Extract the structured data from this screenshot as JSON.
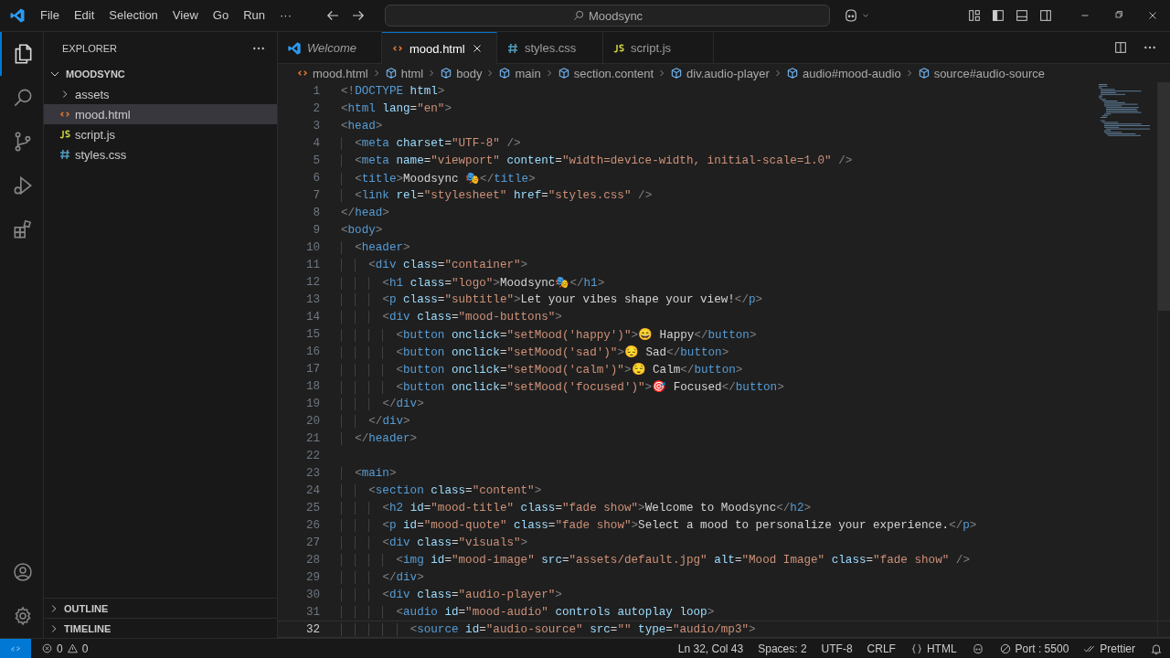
{
  "title_bar": {
    "menu": [
      "File",
      "Edit",
      "Selection",
      "View",
      "Go",
      "Run",
      "···"
    ],
    "search": "Moodsync"
  },
  "activity_bar": {
    "items": [
      {
        "kind": "explorer",
        "selected": true
      },
      {
        "kind": "search",
        "selected": false
      },
      {
        "kind": "source-control",
        "selected": false
      },
      {
        "kind": "run",
        "selected": false
      },
      {
        "kind": "extensions",
        "selected": false
      }
    ]
  },
  "sidebar": {
    "title": "EXPLORER",
    "folder": "MOODSYNC",
    "expanded": true,
    "items": [
      {
        "name": "assets",
        "kind": "folder",
        "selected": false
      },
      {
        "name": "mood.html",
        "kind": "html",
        "selected": true
      },
      {
        "name": "script.js",
        "kind": "js",
        "selected": false
      },
      {
        "name": "styles.css",
        "kind": "css",
        "selected": false
      }
    ],
    "sections": [
      {
        "name": "OUTLINE",
        "expanded": false
      },
      {
        "name": "TIMELINE",
        "expanded": false
      }
    ]
  },
  "tabs": [
    {
      "label": "Welcome",
      "kind": "welcome",
      "selected": false
    },
    {
      "label": "mood.html",
      "kind": "html",
      "selected": true
    },
    {
      "label": "styles.css",
      "kind": "css",
      "selected": false
    },
    {
      "label": "script.js",
      "kind": "js",
      "selected": false
    }
  ],
  "breadcrumb": [
    {
      "label": "mood.html",
      "kind": "html"
    },
    {
      "label": "html",
      "kind": "element"
    },
    {
      "label": "body",
      "kind": "element"
    },
    {
      "label": "main",
      "kind": "element"
    },
    {
      "label": "section.content",
      "kind": "element"
    },
    {
      "label": "div.audio-player",
      "kind": "element"
    },
    {
      "label": "audio#mood-audio",
      "kind": "element"
    },
    {
      "label": "source#audio-source",
      "kind": "element"
    }
  ],
  "editor": {
    "lines": [
      {
        "number": "1",
        "code": "<!DOCTYPE html>",
        "current": false
      },
      {
        "number": "2",
        "code": "<html lang=\"en\">",
        "current": false
      },
      {
        "number": "3",
        "code": "<head>",
        "current": false
      },
      {
        "number": "4",
        "code": "  <meta charset=\"UTF-8\" />",
        "current": false
      },
      {
        "number": "5",
        "code": "  <meta name=\"viewport\" content=\"width=device-width, initial-scale=1.0\" />",
        "current": false
      },
      {
        "number": "6",
        "code": "  <title>Moodsync 🎭</title>",
        "current": false
      },
      {
        "number": "7",
        "code": "  <link rel=\"stylesheet\" href=\"styles.css\" />",
        "current": false
      },
      {
        "number": "8",
        "code": "</head>",
        "current": false
      },
      {
        "number": "9",
        "code": "<body>",
        "current": false
      },
      {
        "number": "10",
        "code": "  <header>",
        "current": false
      },
      {
        "number": "11",
        "code": "    <div class=\"container\">",
        "current": false
      },
      {
        "number": "12",
        "code": "      <h1 class=\"logo\">Moodsync🎭</h1>",
        "current": false
      },
      {
        "number": "13",
        "code": "      <p class=\"subtitle\">Let your vibes shape your view!</p>",
        "current": false
      },
      {
        "number": "14",
        "code": "      <div class=\"mood-buttons\">",
        "current": false
      },
      {
        "number": "15",
        "code": "        <button onclick=\"setMood('happy')\">😄 Happy</button>",
        "current": false
      },
      {
        "number": "16",
        "code": "        <button onclick=\"setMood('sad')\">😔 Sad</button>",
        "current": false
      },
      {
        "number": "17",
        "code": "        <button onclick=\"setMood('calm')\">😌 Calm</button>",
        "current": false
      },
      {
        "number": "18",
        "code": "        <button onclick=\"setMood('focused')\">🎯 Focused</button>",
        "current": false
      },
      {
        "number": "19",
        "code": "      </div>",
        "current": false
      },
      {
        "number": "20",
        "code": "    </div>",
        "current": false
      },
      {
        "number": "21",
        "code": "  </header>",
        "current": false
      },
      {
        "number": "22",
        "current": false
      },
      {
        "number": "23",
        "code": "  <main>",
        "current": false
      },
      {
        "number": "24",
        "code": "    <section class=\"content\">",
        "current": false
      },
      {
        "number": "25",
        "code": "      <h2 id=\"mood-title\" class=\"fade show\">Welcome to Moodsync</h2>",
        "current": false
      },
      {
        "number": "26",
        "code": "      <p id=\"mood-quote\" class=\"fade show\">Select a mood to personalize your experience.</p>",
        "current": false
      },
      {
        "number": "27",
        "code": "      <div class=\"visuals\">",
        "current": false
      },
      {
        "number": "28",
        "code": "        <img id=\"mood-image\" src=\"assets/default.jpg\" alt=\"Mood Image\" class=\"fade show\" />",
        "current": false
      },
      {
        "number": "29",
        "code": "      </div>",
        "current": false
      },
      {
        "number": "30",
        "code": "      <div class=\"audio-player\">",
        "current": false
      },
      {
        "number": "31",
        "code": "        <audio id=\"mood-audio\" controls autoplay loop>",
        "current": false
      },
      {
        "number": "32",
        "code": "          <source id=\"audio-source\" src=\"\" type=\"audio/mp3\">",
        "current": true
      }
    ]
  },
  "status_bar": {
    "errors": "0",
    "warnings": "0",
    "items": [
      {
        "label": "Ln 32, Col 43",
        "kind": "text"
      },
      {
        "label": "Spaces: 2",
        "kind": "text"
      },
      {
        "label": "UTF-8",
        "kind": "text"
      },
      {
        "label": "CRLF",
        "kind": "text"
      },
      {
        "label": "HTML",
        "kind": "language"
      },
      {
        "kind": "copilot"
      },
      {
        "label": "Port : 5500",
        "kind": "port"
      },
      {
        "label": "Prettier",
        "kind": "prettier"
      },
      {
        "kind": "bell"
      }
    ]
  }
}
